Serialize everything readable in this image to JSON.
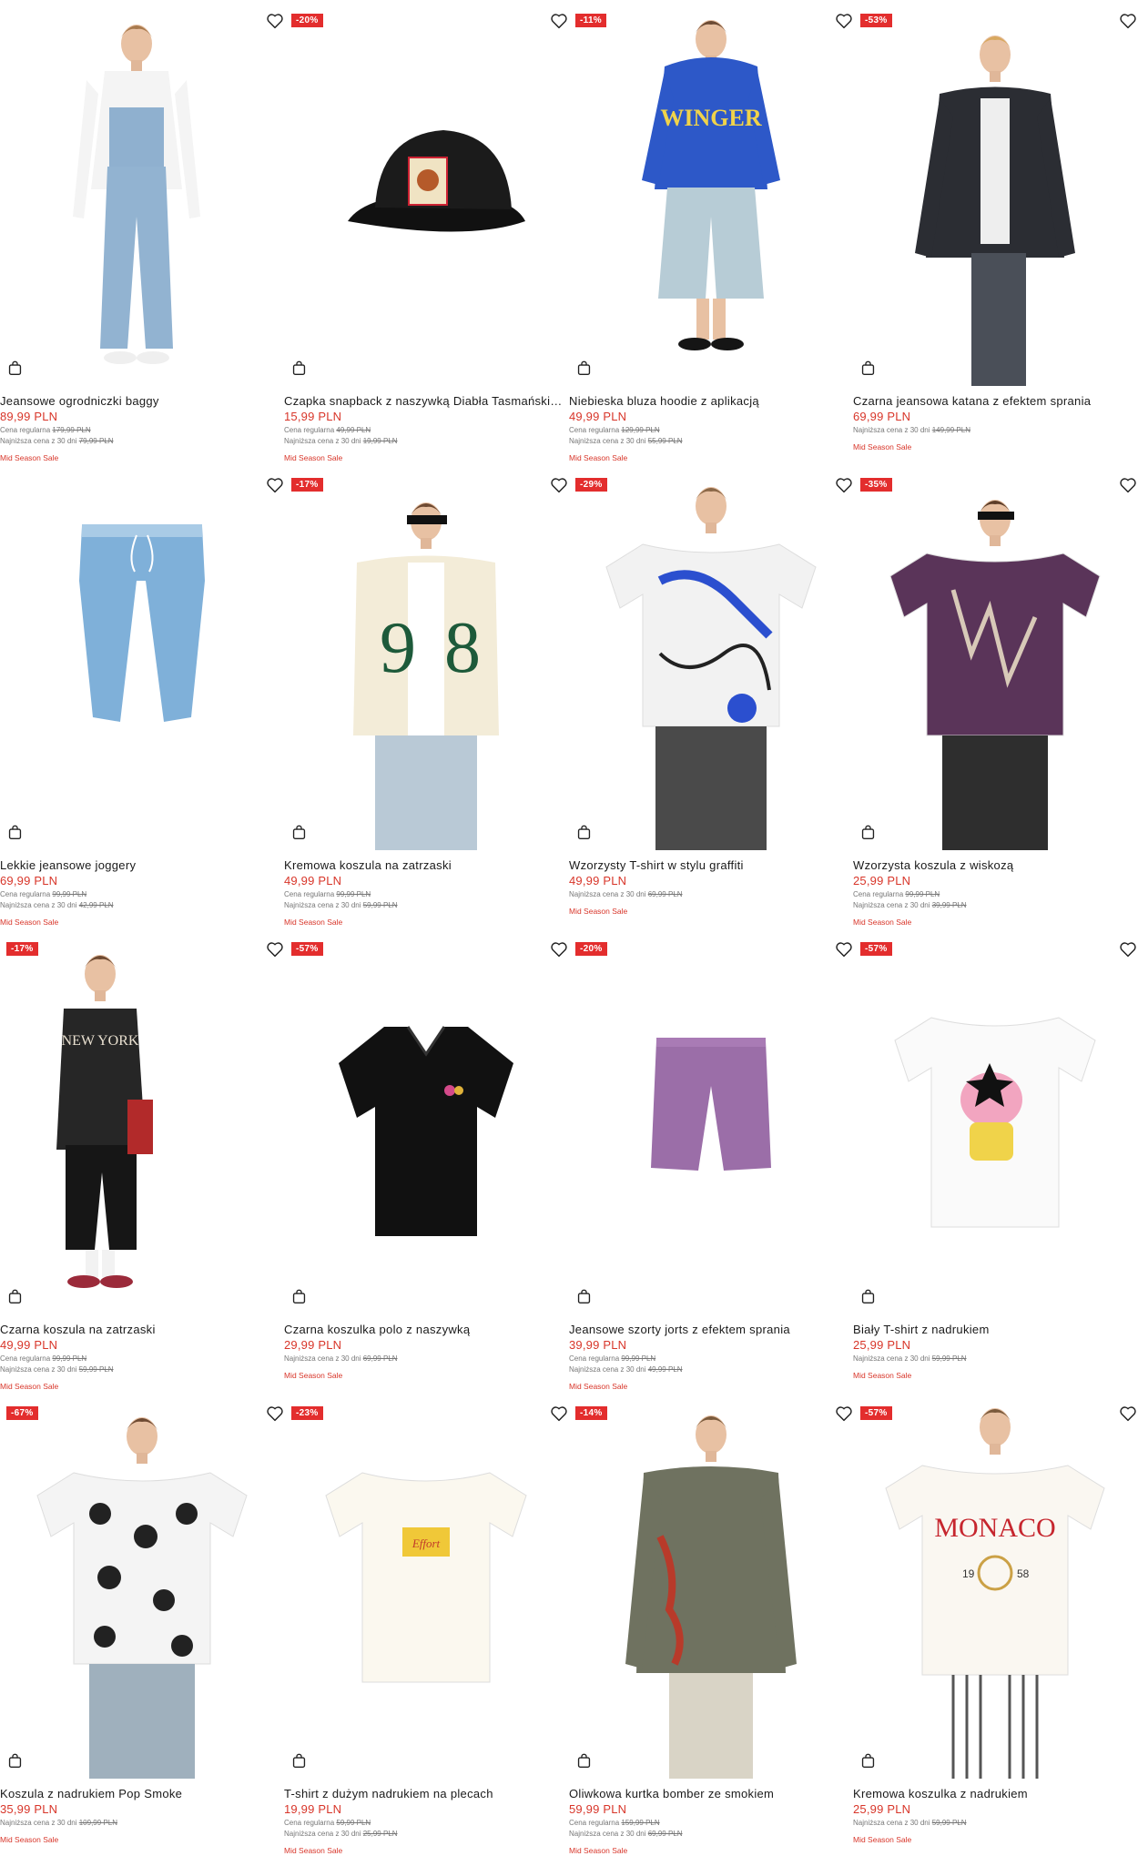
{
  "products": [
    {
      "name": "Jeansowe ogrodniczki baggy",
      "price": "89,99 PLN",
      "regular_label": "Cena regularna",
      "regular": "179,99 PLN",
      "lowest_label": "Najniższa cena z 30 dni",
      "lowest": "79,99 PLN",
      "sale": "Mid Season Sale",
      "badge": "-20%",
      "img": "overalls",
      "bg": "#ffffff"
    },
    {
      "name": "Czapka snapback z naszywką Diabła Tasmańskiego",
      "price": "15,99 PLN",
      "regular_label": "Cena regularna",
      "regular": "49,99 PLN",
      "lowest_label": "Najniższa cena z 30 dni",
      "lowest": "19,99 PLN",
      "sale": "Mid Season Sale",
      "badge": "-11%",
      "img": "cap",
      "bg": "#ffffff"
    },
    {
      "name": "Niebieska bluza hoodie z aplikacją",
      "price": "49,99 PLN",
      "regular_label": "Cena regularna",
      "regular": "129,99 PLN",
      "lowest_label": "Najniższa cena z 30 dni",
      "lowest": "55,99 PLN",
      "sale": "Mid Season Sale",
      "badge": "-53%",
      "img": "hoodie",
      "bg": "#ffffff"
    },
    {
      "name": "Czarna jeansowa katana z efektem sprania",
      "price": "69,99 PLN",
      "regular_label": "",
      "regular": "",
      "lowest_label": "Najniższa cena z 30 dni",
      "lowest": "149,99 PLN",
      "sale": "Mid Season Sale",
      "badge": "",
      "img": "jacket",
      "bg": "#ffffff"
    },
    {
      "name": "Lekkie jeansowe joggery",
      "price": "69,99 PLN",
      "regular_label": "Cena regularna",
      "regular": "99,99 PLN",
      "lowest_label": "Najniższa cena z 30 dni",
      "lowest": "42,99 PLN",
      "sale": "Mid Season Sale",
      "badge": "-17%",
      "img": "joggers",
      "bg": "#ffffff"
    },
    {
      "name": "Kremowa koszula na zatrzaski",
      "price": "49,99 PLN",
      "regular_label": "Cena regularna",
      "regular": "99,99 PLN",
      "lowest_label": "Najniższa cena z 30 dni",
      "lowest": "59,99 PLN",
      "sale": "Mid Season Sale",
      "badge": "-29%",
      "img": "varsity",
      "bg": "#ffffff"
    },
    {
      "name": "Wzorzysty T-shirt w stylu graffiti",
      "price": "49,99 PLN",
      "regular_label": "",
      "regular": "",
      "lowest_label": "Najniższa cena z 30 dni",
      "lowest": "69,99 PLN",
      "sale": "Mid Season Sale",
      "badge": "-35%",
      "img": "graffiti",
      "bg": "#ffffff"
    },
    {
      "name": "Wzorzysta koszula z wiskozą",
      "price": "25,99 PLN",
      "regular_label": "Cena regularna",
      "regular": "99,99 PLN",
      "lowest_label": "Najniższa cena z 30 dni",
      "lowest": "39,99 PLN",
      "sale": "Mid Season Sale",
      "badge": "",
      "img": "purpleshirt",
      "bg": "#ffffff"
    },
    {
      "name": "Czarna koszula na zatrzaski",
      "price": "49,99 PLN",
      "regular_label": "Cena regularna",
      "regular": "99,99 PLN",
      "lowest_label": "Najniższa cena z 30 dni",
      "lowest": "59,99 PLN",
      "sale": "Mid Season Sale",
      "badge": "-57%",
      "img": "blackshirt",
      "bg": "#ffffff",
      "selfbadge": "-17%"
    },
    {
      "name": "Czarna koszulka polo z naszywką",
      "price": "29,99 PLN",
      "regular_label": "",
      "regular": "",
      "lowest_label": "Najniższa cena z 30 dni",
      "lowest": "69,99 PLN",
      "sale": "Mid Season Sale",
      "badge": "-20%",
      "img": "polo",
      "bg": "#ffffff"
    },
    {
      "name": "Jeansowe szorty jorts z efektem sprania",
      "price": "39,99 PLN",
      "regular_label": "Cena regularna",
      "regular": "99,99 PLN",
      "lowest_label": "Najniższa cena z 30 dni",
      "lowest": "49,99 PLN",
      "sale": "Mid Season Sale",
      "badge": "-57%",
      "img": "shorts",
      "bg": "#ffffff"
    },
    {
      "name": "Biały T-shirt z nadrukiem",
      "price": "25,99 PLN",
      "regular_label": "",
      "regular": "",
      "lowest_label": "Najniższa cena z 30 dni",
      "lowest": "59,99 PLN",
      "sale": "Mid Season Sale",
      "badge": "",
      "img": "whitetee",
      "bg": "#ffffff"
    },
    {
      "name": "Koszula z nadrukiem Pop Smoke",
      "price": "35,99 PLN",
      "regular_label": "",
      "regular": "",
      "lowest_label": "Najniższa cena z 30 dni",
      "lowest": "109,99 PLN",
      "sale": "Mid Season Sale",
      "badge": "-23%",
      "img": "popsmoke",
      "bg": "#ffffff",
      "selfbadge": "-67%"
    },
    {
      "name": "T-shirt z dużym nadrukiem na plecach",
      "price": "19,99 PLN",
      "regular_label": "Cena regularna",
      "regular": "59,99 PLN",
      "lowest_label": "Najniższa cena z 30 dni",
      "lowest": "25,99 PLN",
      "sale": "Mid Season Sale",
      "badge": "-14%",
      "img": "creamtee",
      "bg": "#ffffff"
    },
    {
      "name": "Oliwkowa kurtka bomber ze smokiem",
      "price": "59,99 PLN",
      "regular_label": "Cena regularna",
      "regular": "159,99 PLN",
      "lowest_label": "Najniższa cena z 30 dni",
      "lowest": "69,99 PLN",
      "sale": "Mid Season Sale",
      "badge": "-57%",
      "img": "bomber",
      "bg": "#ffffff"
    },
    {
      "name": "Kremowa koszulka z nadrukiem",
      "price": "25,99 PLN",
      "regular_label": "",
      "regular": "",
      "lowest_label": "Najniższa cena z 30 dni",
      "lowest": "59,99 PLN",
      "sale": "Mid Season Sale",
      "badge": "",
      "img": "monaco",
      "bg": "#ffffff"
    }
  ],
  "icons": {
    "wishlist": "heart-icon",
    "cart": "bag-icon"
  },
  "colors": {
    "accent": "#d8362a",
    "badge": "#e32d2d"
  }
}
